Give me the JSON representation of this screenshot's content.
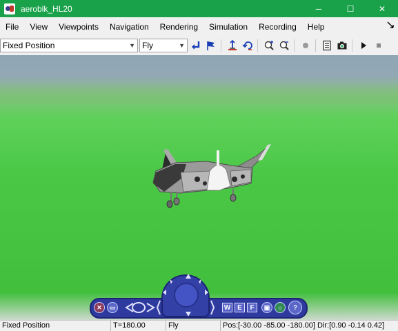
{
  "window": {
    "title": "aeroblk_HL20",
    "controls": {
      "minimize": "─",
      "maximize": "☐",
      "close": "✕"
    }
  },
  "menu": {
    "items": [
      "File",
      "View",
      "Viewpoints",
      "Navigation",
      "Rendering",
      "Simulation",
      "Recording",
      "Help"
    ],
    "pin_icon": "pin-icon"
  },
  "toolbar": {
    "viewpoint_select": "Fixed Position",
    "nav_mode_select": "Fly",
    "buttons": [
      "return-to-viewpoint-icon",
      "create-viewpoint-icon",
      "straighten-up-icon",
      "undo-move-icon",
      "zoom-in-icon",
      "zoom-out-icon",
      "record-icon",
      "block-parameters-icon",
      "snapshot-icon",
      "play-icon",
      "stop-icon"
    ]
  },
  "nav_panel": {
    "keys": [
      "W",
      "E",
      "F"
    ],
    "help": "?"
  },
  "status": {
    "viewpoint": "Fixed Position",
    "time": "T=180.00",
    "mode": "Fly",
    "position": "Pos:[-30.00 -85.00 -180.00] Dir:[0.90 -0.14 0.42]"
  },
  "colors": {
    "titlebar": "#19a24a",
    "nav_panel": "#2f3a9e",
    "ground": "#49c745",
    "sky": "#8fa6b4"
  }
}
